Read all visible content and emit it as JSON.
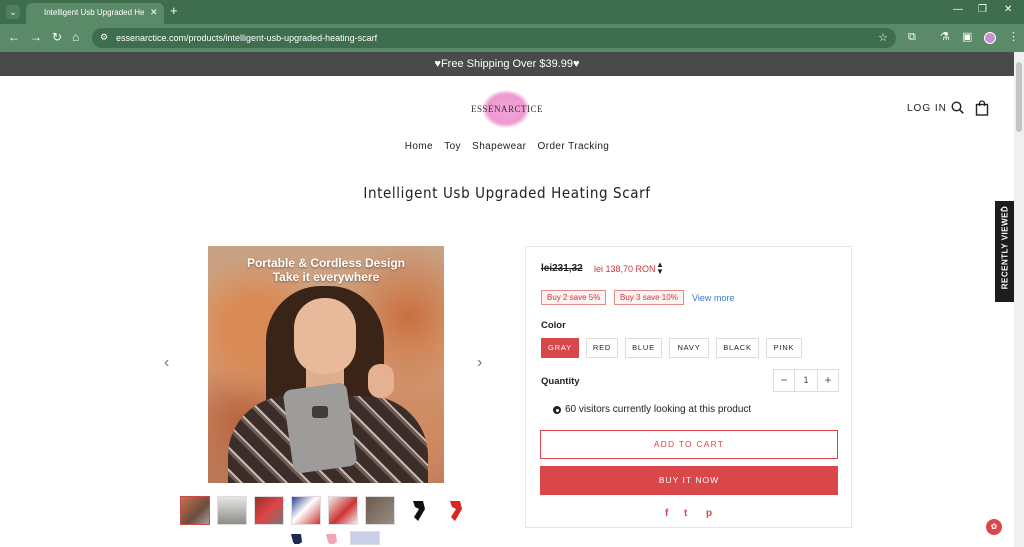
{
  "browser": {
    "tab_title": "Intelligent Usb Upgraded Heati",
    "url": "essenarctice.com/products/intelligent-usb-upgraded-heating-scarf"
  },
  "announcement": "♥Free Shipping Over $39.99♥",
  "header": {
    "logo_text": "ESSENARCTICE",
    "login_label": "LOG IN",
    "nav": [
      "Home",
      "Toy",
      "Shapewear",
      "Order Tracking"
    ]
  },
  "product": {
    "title": "Intelligent Usb Upgraded Heating Scarf",
    "image_caption_line1": "Portable & Cordless Design",
    "image_caption_line2": "Take it everywhere",
    "price_compare": "lei231,32",
    "price_sale": "lei 138,70 RON",
    "discounts": [
      "Buy 2 save 5%",
      "Buy 3 save 10%"
    ],
    "view_more": "View more",
    "color_label": "Color",
    "colors": [
      "GRAY",
      "RED",
      "BLUE",
      "NAVY",
      "BLACK",
      "PINK"
    ],
    "selected_color": "GRAY",
    "quantity_label": "Quantity",
    "quantity": "1",
    "visitors_text": "60 visitors currently looking at this product",
    "add_to_cart": "ADD TO CART",
    "buy_now": "BUY IT NOW",
    "share": [
      "f",
      "t",
      "p"
    ]
  },
  "recently_viewed": "RECENTLY VIEWED",
  "colors": {
    "accent": "#d9474a",
    "chrome": "#5b8a69",
    "announcement_bg": "#4a4a4a"
  }
}
